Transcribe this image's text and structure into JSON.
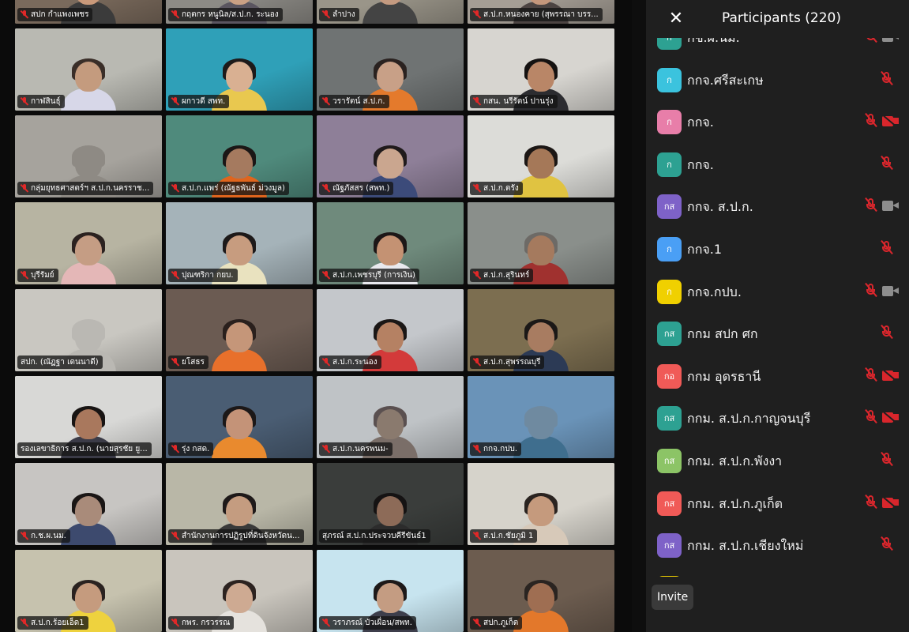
{
  "gallery": {
    "tiles": [
      {
        "name": "สปก กำแพงเพชร",
        "bg": "#7a6a5c",
        "face": "#c9997a",
        "hair": "#2a201c",
        "shirt": "#3b3b3b",
        "muted": true
      },
      {
        "name": "กฤตกร หนูนิล/ส.ป.ก. ระนอง",
        "bg": "#8d8b86",
        "face": "#caa084",
        "hair": "#2b2322",
        "shirt": "#5a5560",
        "muted": true
      },
      {
        "name": "ลำปาง",
        "bg": "#9a9589",
        "face": "#c49a80",
        "hair": "#201a18",
        "shirt": "#444",
        "muted": true
      },
      {
        "name": "ส.ป.ก.หนองคาย (สุพรรณา บรร...",
        "bg": "#a59e95",
        "face": "#c5977b",
        "hair": "#221b1a",
        "shirt": "#4c4442",
        "muted": true
      },
      {
        "name": "กาฬสินธุ์",
        "bg": "#b9b9b2",
        "face": "#c49b7e",
        "hair": "#3a2e28",
        "shirt": "#d7d7e8",
        "muted": true
      },
      {
        "name": "ผกาวดี สพท.",
        "bg": "#2fa0b8",
        "face": "#d9b092",
        "hair": "#1d1a1a",
        "shirt": "#e9c84f",
        "muted": true
      },
      {
        "name": "วรารัตน์ ส.ป.ก.",
        "bg": "#6f7373",
        "face": "#c8a087",
        "hair": "#2a2220",
        "shirt": "#e47a2c",
        "muted": true
      },
      {
        "name": "กสน. นรีรัตน์ ปานรุ่ง",
        "bg": "#d7d5d0",
        "face": "#b98667",
        "hair": "#151211",
        "shirt": "#2c2c30",
        "muted": true
      },
      {
        "name": "กลุ่มยุทธศาสตร์ฯ ส.ป.ก.นครราช...",
        "bg": "#a6a39d",
        "face": "#8e8a84",
        "hair": "#8e8a84",
        "shirt": "#8e8a84",
        "muted": true
      },
      {
        "name": "ส.ป.ก.แพร่ (ณัฐธพันธ์ ม่วงมูล)",
        "bg": "#4f8a7c",
        "face": "#a57a5f",
        "hair": "#1b1716",
        "shirt": "#e0651d",
        "muted": true
      },
      {
        "name": "ณัฐภัสสร (สพท.)",
        "bg": "#8e7f98",
        "face": "#caa68f",
        "hair": "#201b1c",
        "shirt": "#3c4b7a",
        "muted": true
      },
      {
        "name": "ส.ป.ก.ตรัง",
        "bg": "#dcdcd8",
        "face": "#a57858",
        "hair": "#1c1715",
        "shirt": "#e0c341",
        "muted": true
      },
      {
        "name": "บุรีรัมย์",
        "bg": "#b7b4a2",
        "face": "#c59d84",
        "hair": "#2b2220",
        "shirt": "#e4b7b7",
        "muted": true
      },
      {
        "name": "ปุณฑริกา กยบ.",
        "bg": "#a5b3b9",
        "face": "#c79c7f",
        "hair": "#1d1919",
        "shirt": "#e9e2bf",
        "muted": true
      },
      {
        "name": "ส.ป.ก.เพชรบุรี (การเงิน)",
        "bg": "#6f8a7c",
        "face": "#c49273",
        "hair": "#1c1717",
        "shirt": "#e9e9ee",
        "muted": true
      },
      {
        "name": "ส.ป.ก.สุรินทร์",
        "bg": "#8a8f8b",
        "face": "#a57a5e",
        "hair": "#6d6a66",
        "shirt": "#a0312f",
        "muted": true
      },
      {
        "name": "สปก. (ณัฏฐา เดนนาดี)",
        "bg": "#c9c7c1",
        "face": "#bab8b3",
        "hair": "#bab8b3",
        "shirt": "#bab8b3",
        "muted": false
      },
      {
        "name": "ยโสธร",
        "bg": "#6b5b52",
        "face": "#c59679",
        "hair": "#2a201d",
        "shirt": "#e8702b",
        "muted": true
      },
      {
        "name": "ส.ป.ก.ระนอง",
        "bg": "#c4c7cb",
        "face": "#b58163",
        "hair": "#1b1716",
        "shirt": "#d33a3a",
        "muted": true
      },
      {
        "name": "ส.ป.ก.สุพรรณบุรี",
        "bg": "#7c6e50",
        "face": "#a87c61",
        "hair": "#1b1817",
        "shirt": "#2c3a55",
        "muted": true
      },
      {
        "name": "รองเลขาธิการ ส.ป.ก. (นายสุรชัย ยู...",
        "bg": "#d8d8d6",
        "face": "#a9785d",
        "hair": "#181413",
        "shirt": "#3b3b47",
        "muted": false,
        "active": true
      },
      {
        "name": "รุ่ง กสด.",
        "bg": "#4a5d73",
        "face": "#c49378",
        "hair": "#1c1818",
        "shirt": "#e98a2e",
        "muted": true
      },
      {
        "name": "ส.ป.ก.นครพนม-",
        "bg": "#bfc3c6",
        "face": "#8a7a6e",
        "hair": "#5a5050",
        "shirt": "#7a6e68",
        "muted": true
      },
      {
        "name": "กกจ.กปบ.",
        "bg": "#6a93b8",
        "face": "#6f8aa0",
        "hair": "#6f8aa0",
        "shirt": "#3f6e8e",
        "muted": true
      },
      {
        "name": "ก.ช.ผ.นม.",
        "bg": "#c7c5c2",
        "face": "#a98b7a",
        "hair": "#1a1615",
        "shirt": "#3d4a6e",
        "muted": true
      },
      {
        "name": "สำนักงานการปฏิรูปที่ดินจังหวัดน...",
        "bg": "#b9b7a7",
        "face": "#c49c80",
        "hair": "#1e1919",
        "shirt": "#3a3a3a",
        "muted": true
      },
      {
        "name": "สุภรณ์ ส.ป.ก.ประจวบคีรีขันธ์1",
        "bg": "#3a3d3b",
        "face": "#8d6b58",
        "hair": "#151313",
        "shirt": "#2c2c2c",
        "muted": false
      },
      {
        "name": "ส.ป.ก.ชัยภูมิ 1",
        "bg": "#d6d3cb",
        "face": "#c59a7d",
        "hair": "#2a2320",
        "shirt": "#d7c9b9",
        "muted": true
      },
      {
        "name": "ส.ป.ก.ร้อยเอ็ด1",
        "bg": "#c6c2ae",
        "face": "#c59b7e",
        "hair": "#2a2220",
        "shirt": "#eed23e",
        "muted": true
      },
      {
        "name": "กพร. กรวรรณ",
        "bg": "#c9c5bd",
        "face": "#ceaa92",
        "hair": "#2c2320",
        "shirt": "#e5e2dd",
        "muted": true
      },
      {
        "name": "วราภรณ์ บัวเผื่อน/สพท.",
        "bg": "#c7e4ef",
        "face": "#c49c82",
        "hair": "#1d1919",
        "shirt": "#3d3e4b",
        "muted": true
      },
      {
        "name": "สปก.ภูเก็ต",
        "bg": "#6c5c4f",
        "face": "#9f6e52",
        "hair": "#2a2421",
        "shirt": "#e3782b",
        "muted": true
      }
    ]
  },
  "panel": {
    "close_icon": "✕",
    "title": "Participants (220)",
    "invite_label": "Invite",
    "participants": [
      {
        "initial": "ก",
        "name": "กช.ผ.นม.",
        "color": "#2da192",
        "mic_muted": true,
        "cam": "on"
      },
      {
        "initial": "ก",
        "name": "กกจ.ศรีสะเกษ",
        "color": "#3bc3de",
        "mic_muted": true,
        "cam": "none"
      },
      {
        "initial": "ก",
        "name": "กกจ.",
        "color": "#e87ea9",
        "mic_muted": true,
        "cam": "off"
      },
      {
        "initial": "ก",
        "name": "กกจ.",
        "color": "#2da192",
        "mic_muted": true,
        "cam": "none"
      },
      {
        "initial": "กส",
        "name": "กกจ. ส.ป.ก.",
        "color": "#7e62c8",
        "mic_muted": true,
        "cam": "on"
      },
      {
        "initial": "ก",
        "name": "กกจ.1",
        "color": "#4a9ff5",
        "mic_muted": true,
        "cam": "none"
      },
      {
        "initial": "ก",
        "name": "กกจ.กปบ.",
        "color": "#f0d000",
        "mic_muted": true,
        "cam": "on"
      },
      {
        "initial": "กส",
        "name": "กกม สปก ศก",
        "color": "#2da192",
        "mic_muted": true,
        "cam": "none"
      },
      {
        "initial": "กอ",
        "name": "กกม อุดรธานี",
        "color": "#f05a57",
        "mic_muted": true,
        "cam": "off"
      },
      {
        "initial": "กส",
        "name": "กกม. ส.ป.ก.กาญจนบุรี",
        "color": "#2da192",
        "mic_muted": true,
        "cam": "off"
      },
      {
        "initial": "กส",
        "name": "กกม. ส.ป.ก.พังงา",
        "color": "#8cc466",
        "mic_muted": true,
        "cam": "none"
      },
      {
        "initial": "กส",
        "name": "กกม. ส.ป.ก.ภูเก็ต",
        "color": "#f05a57",
        "mic_muted": true,
        "cam": "off"
      },
      {
        "initial": "กส",
        "name": "กกม. ส.ป.ก.เชียงใหม่",
        "color": "#7e62c8",
        "mic_muted": true,
        "cam": "none"
      },
      {
        "initial": "",
        "name": "",
        "color": "#f0d000",
        "mic_muted": false,
        "cam": "none"
      }
    ]
  }
}
